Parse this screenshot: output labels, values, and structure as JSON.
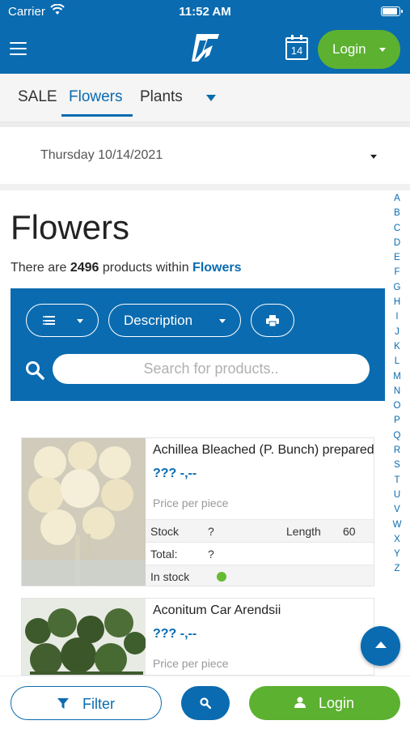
{
  "status_bar": {
    "carrier": "Carrier",
    "time": "11:52 AM"
  },
  "header": {
    "calendar_day": "14",
    "login_label": "Login"
  },
  "tabs": [
    {
      "label": "SALE",
      "active": false
    },
    {
      "label": "Flowers",
      "active": true
    },
    {
      "label": "Plants",
      "active": false
    }
  ],
  "date_selector": {
    "value": "Thursday 10/14/2021"
  },
  "page": {
    "title": "Flowers",
    "count_prefix": "There are",
    "count": "2496",
    "count_middle": "products within",
    "category": "Flowers"
  },
  "alphabet": [
    "A",
    "B",
    "C",
    "D",
    "E",
    "F",
    "G",
    "H",
    "I",
    "J",
    "K",
    "L",
    "M",
    "N",
    "O",
    "P",
    "Q",
    "R",
    "S",
    "T",
    "U",
    "V",
    "W",
    "X",
    "Y",
    "Z"
  ],
  "search_panel": {
    "sort_label": "Description",
    "search_placeholder": "Search for products.."
  },
  "products": [
    {
      "name": "Achillea Bleached (P. Bunch) prepared",
      "price": "??? -,--",
      "price_note": "Price per piece",
      "stock_label": "Stock",
      "stock_value": "?",
      "length_label": "Length",
      "length_value": "60",
      "total_label": "Total:",
      "total_value": "?",
      "availability": "In stock"
    },
    {
      "name": "Aconitum Car Arendsii",
      "price": "??? -,--",
      "price_note": "Price per piece"
    }
  ],
  "bottom_bar": {
    "filter_label": "Filter",
    "login_label": "Login"
  },
  "colors": {
    "primary": "#0a6bb0",
    "accent_green": "#5cb130",
    "in_stock": "#66bb33"
  },
  "icons": [
    "menu-icon",
    "logo-icon",
    "calendar-icon",
    "caret-down-icon",
    "list-view-icon",
    "print-icon",
    "search-icon",
    "scroll-top-icon",
    "filter-icon",
    "user-icon"
  ]
}
